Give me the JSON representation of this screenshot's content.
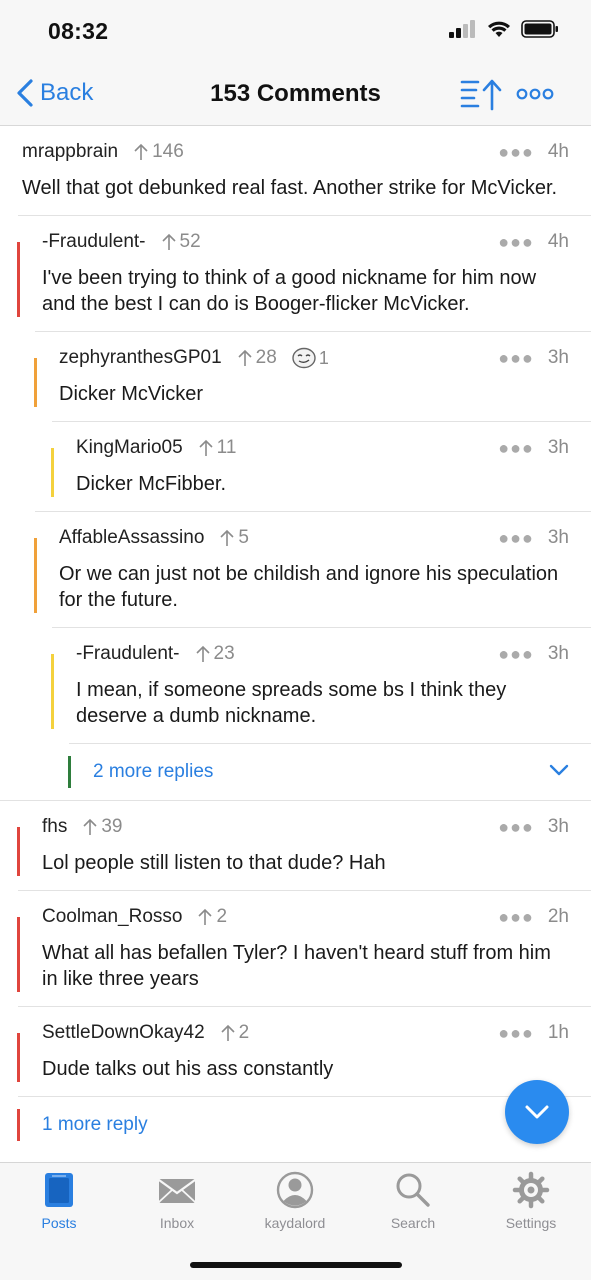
{
  "status": {
    "time": "08:32"
  },
  "nav": {
    "back_label": "Back",
    "title": "153 Comments"
  },
  "comments": [
    {
      "author": "mrappbrain",
      "votes": "146",
      "age": "4h",
      "text": "Well that got debunked real fast. Another strike for McVicker.",
      "depth": 0
    },
    {
      "author": "-Fraudulent-",
      "votes": "52",
      "age": "4h",
      "text": "I've been trying to think of a good nickname for him now and the best I can do is Booger-flicker McVicker.",
      "depth": 1,
      "bar_color": "#e0453d"
    },
    {
      "author": "zephyranthesGP01",
      "votes": "28",
      "award_count": "1",
      "age": "3h",
      "text": "Dicker McVicker",
      "depth": 2,
      "bar_color": "#f0a13a"
    },
    {
      "author": "KingMario05",
      "votes": "11",
      "age": "3h",
      "text": "Dicker McFibber.",
      "depth": 3,
      "bar_color": "#f4d13d"
    },
    {
      "author": "AffableAssassino",
      "votes": "5",
      "age": "3h",
      "text": "Or we can just not be childish and ignore his speculation for the future.",
      "depth": 2,
      "bar_color": "#f0a13a"
    },
    {
      "author": "-Fraudulent-",
      "votes": "23",
      "age": "3h",
      "text": "I mean, if someone spreads some bs I think they deserve a dumb nickname.",
      "depth": 3,
      "bar_color": "#f4d13d"
    },
    {
      "author": "fhs",
      "votes": "39",
      "age": "3h",
      "text": "Lol people still listen to that dude? Hah",
      "depth": 1,
      "bar_color": "#e0453d"
    },
    {
      "author": "Coolman_Rosso",
      "votes": "2",
      "age": "2h",
      "text": "What all has befallen Tyler? I haven't heard stuff from him in like three years",
      "depth": 1,
      "bar_color": "#e0453d"
    },
    {
      "author": "SettleDownOkay42",
      "votes": "2",
      "age": "1h",
      "text": "Dude talks out his ass constantly",
      "depth": 1,
      "bar_color": "#e0453d"
    }
  ],
  "more_replies": [
    {
      "label": "2 more replies",
      "bar_color": "#2e7d3c"
    },
    {
      "label": "1 more reply",
      "bar_color": "#e0453d"
    }
  ],
  "tabs": [
    {
      "label": "Posts",
      "icon": "posts-icon",
      "active": true
    },
    {
      "label": "Inbox",
      "icon": "inbox-icon"
    },
    {
      "label": "kaydalord",
      "icon": "profile-icon"
    },
    {
      "label": "Search",
      "icon": "search-icon"
    },
    {
      "label": "Settings",
      "icon": "settings-icon"
    }
  ],
  "colors": {
    "accent": "#2a7fe0",
    "fab": "#2a8bef",
    "depth1": "#e0453d",
    "depth2": "#f0a13a",
    "depth3": "#f4d13d",
    "more_green": "#2e7d3c"
  }
}
